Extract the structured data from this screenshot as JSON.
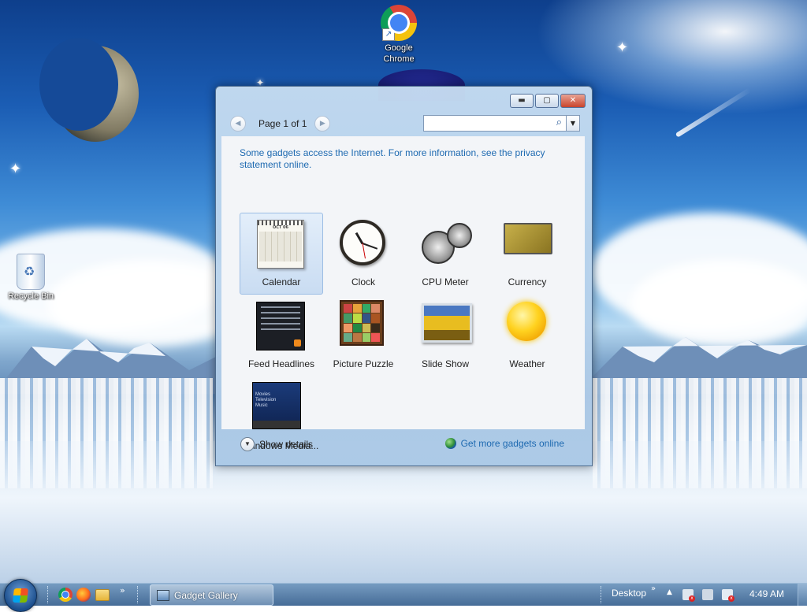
{
  "desktop": {
    "icons": [
      {
        "label": "Google Chrome"
      },
      {
        "label": "Recycle Bin"
      }
    ]
  },
  "window": {
    "title": "Gadget Gallery",
    "controls": {
      "minimize": "minimize-icon",
      "maximize": "maximize-icon",
      "close": "close-icon"
    },
    "pager": {
      "label": "Page 1 of 1"
    },
    "search": {
      "placeholder": "",
      "value": ""
    },
    "notice": "Some gadgets access the Internet.  For more information, see the privacy statement online.",
    "gadgets": [
      {
        "label": "Calendar",
        "selected": true
      },
      {
        "label": "Clock"
      },
      {
        "label": "CPU Meter"
      },
      {
        "label": "Currency"
      },
      {
        "label": "Feed Headlines"
      },
      {
        "label": "Picture Puzzle"
      },
      {
        "label": "Slide Show"
      },
      {
        "label": "Weather"
      },
      {
        "label": "Windows Media..."
      }
    ],
    "calendar_thumb": {
      "month": "OCT 06"
    },
    "media_thumb": {
      "lines": [
        "Movies",
        "Television",
        "Music"
      ]
    },
    "footer": {
      "details": "Show details",
      "online": "Get more gadgets online"
    }
  },
  "taskbar": {
    "quick_launch": [
      "chrome-icon",
      "firefox-icon",
      "file-explorer-icon"
    ],
    "overflow": "»",
    "active_task": "Gadget Gallery",
    "toolbar_label": "Desktop",
    "toolbar_chevron": "»",
    "tray_up": "▲",
    "time": "4:49 AM"
  },
  "colors": {
    "link": "#1e6ab1",
    "selection": "#c9dcf2",
    "close_button": "#c9442c"
  }
}
